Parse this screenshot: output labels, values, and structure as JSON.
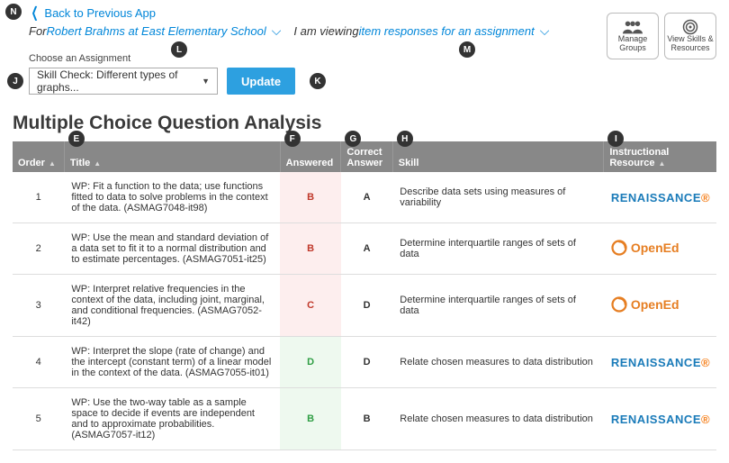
{
  "nav": {
    "back_label": "Back to Previous App"
  },
  "context": {
    "for_prefix": "For ",
    "for_link": "Robert Brahms at East Elementary School",
    "view_prefix": "I am viewing ",
    "view_link": "item responses for an assignment"
  },
  "assignment": {
    "label": "Choose an Assignment",
    "selected": "Skill Check: Different types of graphs...",
    "update_label": "Update"
  },
  "right_buttons": {
    "manage_groups": "Manage Groups",
    "view_skills": "View Skills & Resources"
  },
  "section_title": "Multiple Choice Question Analysis",
  "columns": {
    "order": "Order",
    "title": "Title",
    "answered": "Answered",
    "correct": "Correct Answer",
    "skill": "Skill",
    "resource": "Instructional Resource"
  },
  "rows": [
    {
      "order": "1",
      "title": "WP: Fit a function to the data; use functions fitted to data to solve problems in the context of the data. (ASMAG7048-it98)",
      "answered": "B",
      "correct": "A",
      "is_correct": false,
      "skill": "Describe data sets using measures of variability",
      "resource": "renaissance"
    },
    {
      "order": "2",
      "title": "WP: Use the mean and standard deviation of a data set to fit it to a normal distribution and to estimate percentages. (ASMAG7051-it25)",
      "answered": "B",
      "correct": "A",
      "is_correct": false,
      "skill": "Determine interquartile ranges of sets of data",
      "resource": "opened"
    },
    {
      "order": "3",
      "title": "WP: Interpret relative frequencies in the context of the data, including joint, marginal, and conditional frequencies.  (ASMAG7052-it42)",
      "answered": "C",
      "correct": "D",
      "is_correct": false,
      "skill": "Determine interquartile ranges of sets of data",
      "resource": "opened"
    },
    {
      "order": "4",
      "title": "WP: Interpret the slope (rate of change) and the intercept (constant term) of a linear model in the context of the data. (ASMAG7055-it01)",
      "answered": "D",
      "correct": "D",
      "is_correct": true,
      "skill": "Relate chosen measures to data distribution",
      "resource": "renaissance"
    },
    {
      "order": "5",
      "title": "WP: Use the two-way table as a sample space to decide if events are independent and to approximate probabilities. (ASMAG7057-it12)",
      "answered": "B",
      "correct": "B",
      "is_correct": true,
      "skill": "Relate chosen measures to data distribution",
      "resource": "renaissance"
    }
  ],
  "callouts": {
    "N": "N",
    "L": "L",
    "M": "M",
    "J": "J",
    "K": "K",
    "E": "E",
    "F": "F",
    "G": "G",
    "H": "H",
    "I": "I"
  }
}
